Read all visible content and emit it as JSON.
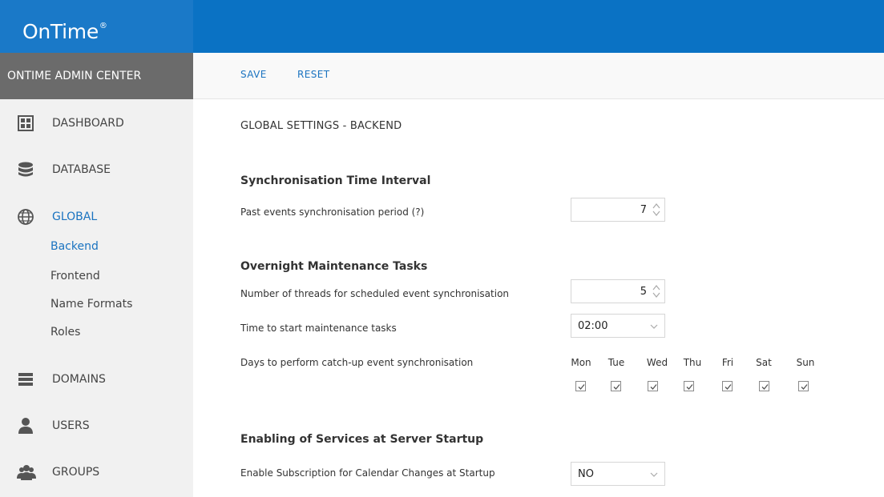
{
  "app": {
    "logo_text": "OnTime",
    "logo_mark": "®"
  },
  "sidebar": {
    "header": "ONTIME ADMIN CENTER",
    "items": [
      {
        "label": "DASHBOARD",
        "icon": "dashboard-icon"
      },
      {
        "label": "DATABASE",
        "icon": "database-icon"
      },
      {
        "label": "GLOBAL",
        "icon": "globe-icon",
        "active": true,
        "subitems": [
          {
            "label": "Backend",
            "active": true
          },
          {
            "label": "Frontend"
          },
          {
            "label": "Name Formats"
          },
          {
            "label": "Roles"
          }
        ]
      },
      {
        "label": "DOMAINS",
        "icon": "domains-icon"
      },
      {
        "label": "USERS",
        "icon": "user-icon"
      },
      {
        "label": "GROUPS",
        "icon": "group-icon"
      }
    ]
  },
  "toolbar": {
    "save_label": "SAVE",
    "reset_label": "RESET"
  },
  "page": {
    "title": "GLOBAL SETTINGS - BACKEND",
    "sync": {
      "heading": "Synchronisation Time Interval",
      "past_events_label": "Past events synchronisation period (?)",
      "past_events_value": "7"
    },
    "maintenance": {
      "heading": "Overnight Maintenance Tasks",
      "threads_label": "Number of threads for scheduled event synchronisation",
      "threads_value": "5",
      "start_time_label": "Time to start maintenance tasks",
      "start_time_value": "02:00",
      "catchup_label": "Days to perform catch-up event synchronisation",
      "days": [
        {
          "label": "Mon",
          "checked": true
        },
        {
          "label": "Tue",
          "checked": true
        },
        {
          "label": "Wed",
          "checked": true
        },
        {
          "label": "Thu",
          "checked": true
        },
        {
          "label": "Fri",
          "checked": true
        },
        {
          "label": "Sat",
          "checked": true
        },
        {
          "label": "Sun",
          "checked": true
        }
      ]
    },
    "startup": {
      "heading": "Enabling of Services at Server Startup",
      "subscription_label": "Enable Subscription for Calendar Changes at Startup",
      "subscription_value": "NO"
    }
  },
  "colors": {
    "brand": "#0a72c4",
    "link": "#1a73c0",
    "sidebar_header": "#6b6b6b",
    "sidebar_bg": "#f1f1f1"
  }
}
